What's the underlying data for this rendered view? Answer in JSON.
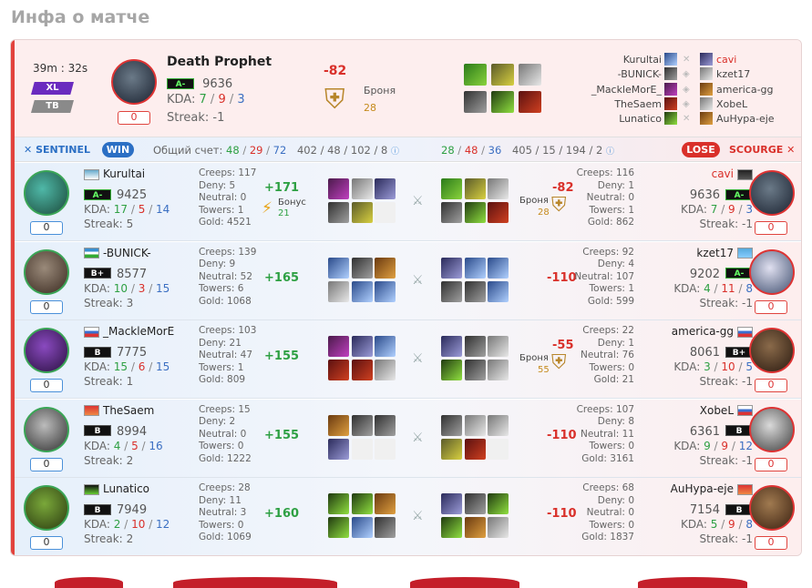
{
  "page_title": "Инфа о матче",
  "match": {
    "duration": "39m : 32s",
    "tag1": "XL",
    "tag2": "TB",
    "hero": "Death Prophet",
    "rank": "A-",
    "mmr": "9636",
    "kda_label": "KDA:",
    "kills": "7",
    "deaths": "9",
    "assists": "3",
    "streak": "Streak: -1",
    "zero": "0",
    "mmr_change": "-82",
    "armor_label": "Броня",
    "armor_value": "28"
  },
  "roster_left": [
    "Kurultai",
    "-BUNICK-",
    "_MackleMorE_",
    "TheSaem",
    "Lunatico"
  ],
  "roster_right": [
    "cavi",
    "kzet17",
    "america-gg",
    "XobeL",
    "AuHypa-eje"
  ],
  "bar": {
    "sentinel": "SENTINEL",
    "win": "WIN",
    "total_label": "Общий счет:",
    "k1": "48",
    "d1": "29",
    "a1": "72",
    "s1": "402 / 48 / 102 / 8",
    "k2": "28",
    "d2": "48",
    "a2": "36",
    "s2": "405 / 15 / 194 / 2",
    "lose": "LOSE",
    "scourge": "SCOURGE"
  },
  "labels": {
    "creeps": "Creeps:",
    "deny": "Deny:",
    "neutral": "Neutral:",
    "towers": "Towers:",
    "gold": "Gold:",
    "kda": "KDA:",
    "streak": "Streak:",
    "bonus": "Бонус",
    "armor": "Броня"
  },
  "players_left": [
    {
      "name": "Kurultai",
      "rank": "A-",
      "mmr": "9425",
      "k": "17",
      "d": "5",
      "a": "14",
      "streak": "5",
      "zero": "0",
      "creeps": "117",
      "deny": "5",
      "neutral": "0",
      "towers": "1",
      "gold": "4521",
      "change": "+171",
      "bonus_value": "21"
    },
    {
      "name": "-BUNICK-",
      "rank": "B+",
      "mmr": "8577",
      "k": "10",
      "d": "3",
      "a": "15",
      "streak": "3",
      "zero": "0",
      "creeps": "139",
      "deny": "9",
      "neutral": "52",
      "towers": "6",
      "gold": "1068",
      "change": "+165"
    },
    {
      "name": "_MackleMorE",
      "rank": "B",
      "mmr": "7775",
      "k": "15",
      "d": "6",
      "a": "15",
      "streak": "1",
      "zero": "0",
      "creeps": "103",
      "deny": "21",
      "neutral": "47",
      "towers": "1",
      "gold": "809",
      "change": "+155"
    },
    {
      "name": "TheSaem",
      "rank": "B",
      "mmr": "8994",
      "k": "4",
      "d": "5",
      "a": "16",
      "streak": "2",
      "zero": "0",
      "creeps": "15",
      "deny": "2",
      "neutral": "0",
      "towers": "0",
      "gold": "1222",
      "change": "+155"
    },
    {
      "name": "Lunatico",
      "rank": "B",
      "mmr": "7949",
      "k": "2",
      "d": "10",
      "a": "12",
      "streak": "2",
      "zero": "0",
      "creeps": "28",
      "deny": "11",
      "neutral": "3",
      "towers": "0",
      "gold": "1069",
      "change": "+160"
    }
  ],
  "players_right": [
    {
      "name": "cavi",
      "rank": "A-",
      "mmr": "9636",
      "k": "7",
      "d": "9",
      "a": "3",
      "streak": "-1",
      "zero": "0",
      "creeps": "116",
      "deny": "1",
      "neutral": "0",
      "towers": "1",
      "gold": "862",
      "change": "-82",
      "armor_value": "28"
    },
    {
      "name": "kzet17",
      "rank": "A-",
      "mmr": "9202",
      "k": "4",
      "d": "11",
      "a": "8",
      "streak": "-1",
      "zero": "0",
      "creeps": "92",
      "deny": "4",
      "neutral": "107",
      "towers": "1",
      "gold": "599",
      "change": "-110"
    },
    {
      "name": "america-gg",
      "rank": "B+",
      "mmr": "8061",
      "k": "3",
      "d": "10",
      "a": "5",
      "streak": "-1",
      "zero": "0",
      "creeps": "22",
      "deny": "1",
      "neutral": "76",
      "towers": "0",
      "gold": "21",
      "change": "-55",
      "armor_value": "55"
    },
    {
      "name": "XobeL",
      "rank": "B",
      "mmr": "6361",
      "k": "9",
      "d": "9",
      "a": "12",
      "streak": "-1",
      "zero": "0",
      "creeps": "107",
      "deny": "8",
      "neutral": "11",
      "towers": "0",
      "gold": "3161",
      "change": "-110"
    },
    {
      "name": "AuHypa-eje",
      "rank": "B",
      "mmr": "7154",
      "k": "5",
      "d": "9",
      "a": "8",
      "streak": "-1",
      "zero": "0",
      "creeps": "68",
      "deny": "0",
      "neutral": "0",
      "towers": "0",
      "gold": "1837",
      "change": "-110"
    }
  ]
}
